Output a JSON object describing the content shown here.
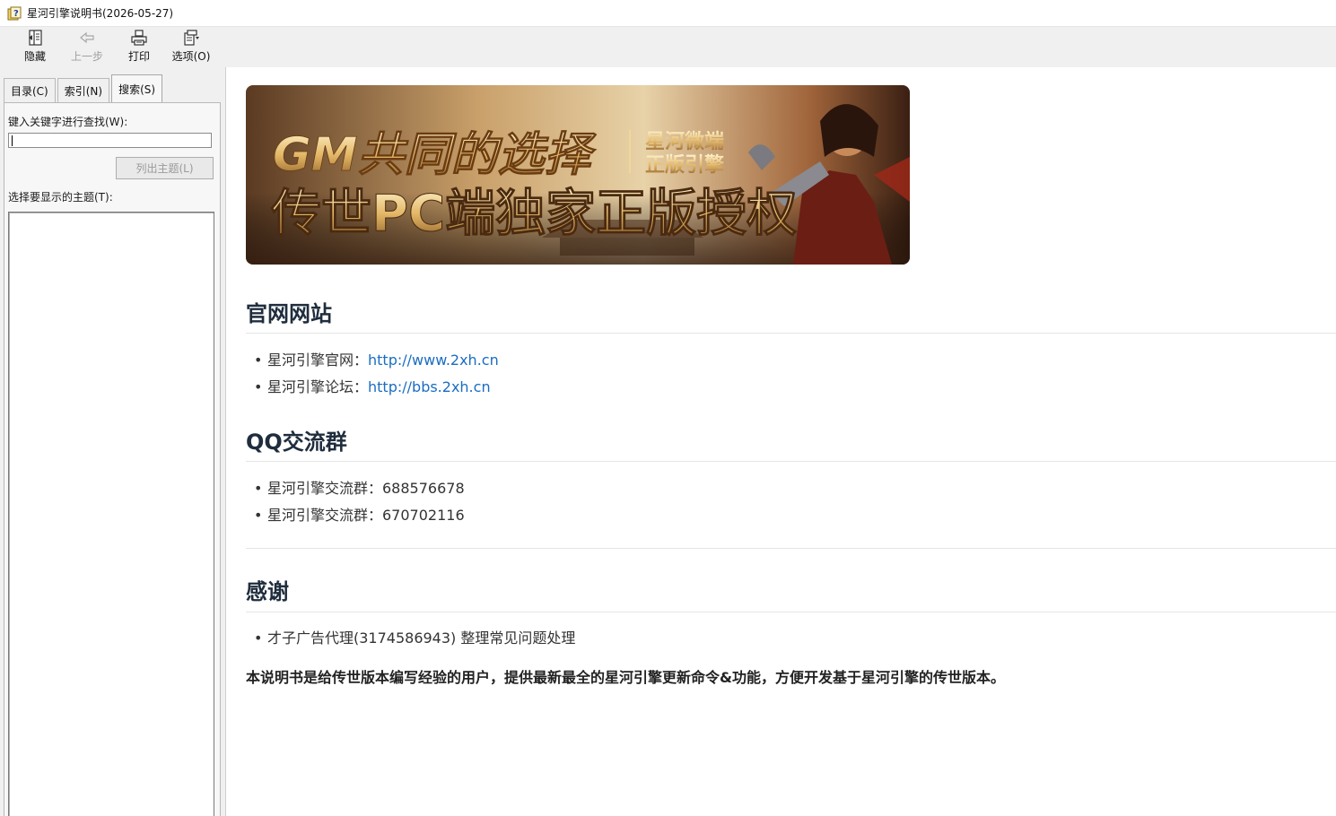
{
  "window": {
    "title": "星河引擎说明书(2026-05-27)"
  },
  "toolbar": {
    "hide_label": "隐藏",
    "back_label": "上一步",
    "print_label": "打印",
    "options_label": "选项(O)"
  },
  "sidebar": {
    "tabs": [
      {
        "label": "目录(C)"
      },
      {
        "label": "索引(N)"
      },
      {
        "label": "搜索(S)"
      }
    ],
    "active_tab": 2,
    "keyword_label": "键入关键字进行查找(W):",
    "keyword_value": "",
    "list_button_label": "列出主题(L)",
    "topics_label": "选择要显示的主题(T):"
  },
  "banner": {
    "line1": "GM共同的选择",
    "line1_side_top": "星河微端",
    "line1_side_bottom": "正版引擎",
    "line2": "传世PC端独家正版授权"
  },
  "sections": {
    "website": {
      "title": "官网网站",
      "items": [
        {
          "prefix": "星河引擎官网：",
          "link": "http://www.2xh.cn"
        },
        {
          "prefix": "星河引擎论坛：",
          "link": "http://bbs.2xh.cn"
        }
      ]
    },
    "qq": {
      "title": "QQ交流群",
      "items": [
        {
          "text": "星河引擎交流群：688576678"
        },
        {
          "text": "星河引擎交流群：670702116"
        }
      ]
    },
    "thanks": {
      "title": "感谢",
      "items": [
        {
          "text": "才子广告代理(3174586943) 整理常见问题处理"
        }
      ]
    }
  },
  "footer_text": "本说明书是给传世版本编写经验的用户，提供最新最全的星河引擎更新命令&功能，方便开发基于星河引擎的传世版本。",
  "colors": {
    "link": "#1a6dc2",
    "heading": "#1f2d3d",
    "toolbar_bg": "#f0f0f0"
  }
}
